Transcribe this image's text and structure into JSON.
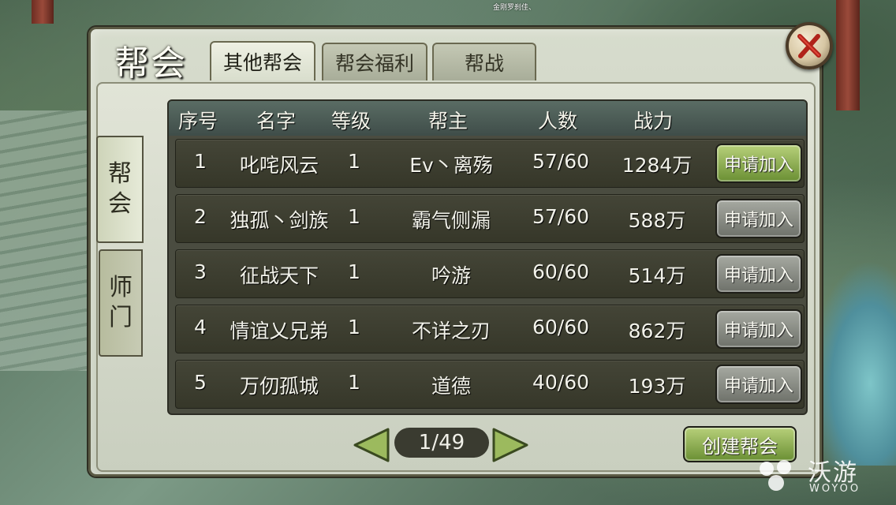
{
  "top_name": "金刚罗刹佳、",
  "panel": {
    "title": "帮会",
    "tabs": [
      {
        "label": "其他帮会",
        "active": true
      },
      {
        "label": "帮会福利",
        "active": false
      },
      {
        "label": "帮战",
        "active": false
      }
    ],
    "close_icon": "red-x-close-icon"
  },
  "side_tabs": [
    {
      "label_lines": [
        "帮",
        "会"
      ],
      "active": true
    },
    {
      "label_lines": [
        "师",
        "门"
      ],
      "active": false
    }
  ],
  "table": {
    "headers": [
      "序号",
      "名字",
      "等级",
      "帮主",
      "人数",
      "战力"
    ],
    "rows": [
      {
        "index": "1",
        "name": "叱咤风云",
        "level": "1",
        "leader": "Ev丶离殇",
        "members": "57/60",
        "power": "1284万",
        "button": "申请加入",
        "button_style": "green"
      },
      {
        "index": "2",
        "name": "独孤丶剑族",
        "level": "1",
        "leader": "霸气侧漏",
        "members": "57/60",
        "power": "588万",
        "button": "申请加入",
        "button_style": "gray"
      },
      {
        "index": "3",
        "name": "征战天下",
        "level": "1",
        "leader": "吟游",
        "members": "60/60",
        "power": "514万",
        "button": "申请加入",
        "button_style": "gray"
      },
      {
        "index": "4",
        "name": "情谊乂兄弟",
        "level": "1",
        "leader": "不详之刃",
        "members": "60/60",
        "power": "862万",
        "button": "申请加入",
        "button_style": "gray"
      },
      {
        "index": "5",
        "name": "万仞孤城",
        "level": "1",
        "leader": "道德",
        "members": "40/60",
        "power": "193万",
        "button": "申请加入",
        "button_style": "gray"
      }
    ]
  },
  "pagination": {
    "current": "1/49",
    "prev_icon": "left-arrow-icon",
    "next_icon": "right-arrow-icon"
  },
  "create_button": "创建帮会",
  "watermark": {
    "cn": "沃游",
    "en": "WOYOO"
  },
  "colors": {
    "accent_green": "#8fb04e",
    "close_red": "#c0281e",
    "row_bg": "#3e3f31"
  }
}
